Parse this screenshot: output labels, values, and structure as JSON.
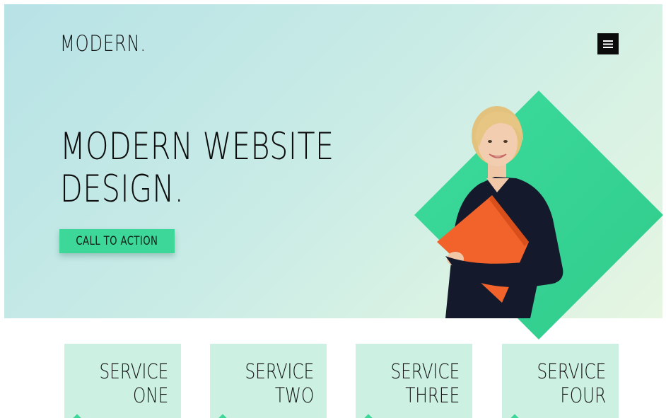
{
  "header": {
    "logo": "MODERN.",
    "menu_icon": "hamburger-menu-icon"
  },
  "hero": {
    "headline_line1": "MODERN WEBSITE",
    "headline_line2": "DESIGN.",
    "cta_label": "CALL TO ACTION"
  },
  "services": [
    {
      "line1": "SERVICE",
      "line2": "ONE"
    },
    {
      "line1": "SERVICE",
      "line2": "TWO"
    },
    {
      "line1": "SERVICE",
      "line2": "THREE"
    },
    {
      "line1": "SERVICE",
      "line2": "FOUR"
    }
  ],
  "colors": {
    "accent": "#3dd899",
    "card_background": "#ccf1e3",
    "text": "#111111",
    "hero_gradient_start": "#b7e2e6",
    "hero_gradient_end": "#e6f6e2",
    "menu_button": "#0b0b0b"
  }
}
